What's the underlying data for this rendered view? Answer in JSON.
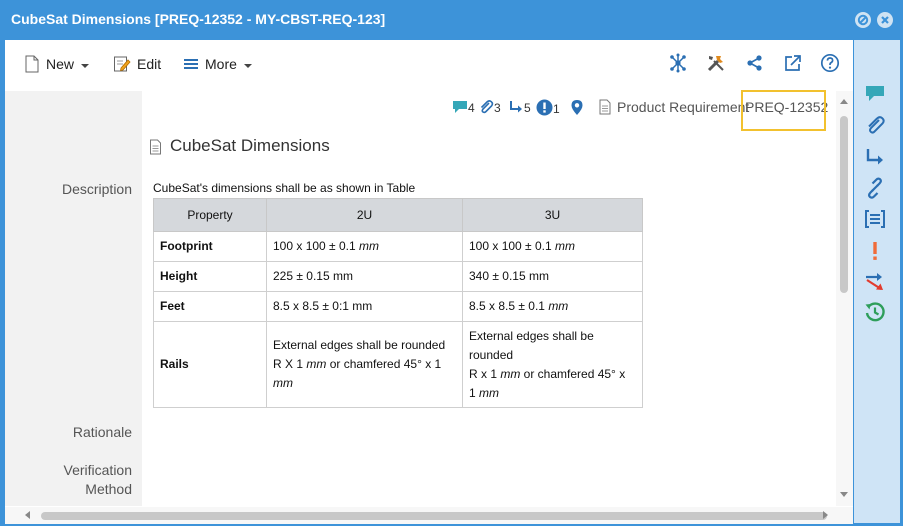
{
  "window": {
    "title": "CubeSat Dimensions [PREQ-12352 - MY-CBST-REQ-123]"
  },
  "toolbar": {
    "new_label": "New",
    "edit_label": "Edit",
    "more_label": "More",
    "right_icons": [
      "network-icon",
      "tools-icon",
      "share-icon",
      "external-link-icon",
      "help-icon"
    ]
  },
  "fields": {
    "description_label": "Description",
    "rationale_label": "Rationale",
    "verification_label_1": "Verification",
    "verification_label_2": "Method"
  },
  "meta": {
    "comments_count": "4",
    "attachments_count": "3",
    "trace_count": "5",
    "issues_count": "1",
    "type_label": "Product Requirement",
    "req_id": "PREQ-12352"
  },
  "item": {
    "name": "CubeSat Dimensions",
    "description_intro": "CubeSat's dimensions shall be as shown in Table"
  },
  "table": {
    "headers": [
      "Property",
      "2U",
      "3U"
    ],
    "rows": [
      {
        "property": "Footprint",
        "c2u": "100 x 100 ± 0.1 ",
        "c2u_unit": "mm",
        "c3u": "100 x 100 ± 0.1 ",
        "c3u_unit": "mm"
      },
      {
        "property": "Height",
        "c2u": "225 ± 0.15 mm",
        "c3u": "340 ± 0.15 mm"
      },
      {
        "property": "Feet",
        "c2u": "8.5 x 8.5 ± 0:1 mm",
        "c3u": "8.5 x 8.5 ± 0.1 ",
        "c3u_unit": "mm"
      },
      {
        "property": "Rails",
        "c2u_l1": "External edges shall be rounded",
        "c2u_l2a": "R X 1 ",
        "c2u_l2_unit": "mm",
        "c2u_l2b": " or chamfered 45° x 1",
        "c2u_l3_unit": "mm",
        "c3u_l1": "External edges shall be",
        "c3u_l2": "rounded",
        "c3u_l3a": "R x 1 ",
        "c3u_l3_unit": "mm",
        "c3u_l3b": " or chamfered 45° x",
        "c3u_l4a": "1 ",
        "c3u_l4_unit": "mm"
      }
    ]
  },
  "sidebar_icons": [
    "comment-icon",
    "attachment-icon",
    "trace-icon",
    "link-icon",
    "list-icon",
    "issue-icon",
    "flow-icon",
    "history-icon"
  ],
  "colors": {
    "titlebar": "#3d93d9",
    "sidebar": "#cfe4f6",
    "highlight": "#f2c12e",
    "accent_blue": "#2b6fb3",
    "teal": "#35a7b8",
    "issue_orange": "#f06b3a",
    "history_green": "#2e9e5a"
  }
}
